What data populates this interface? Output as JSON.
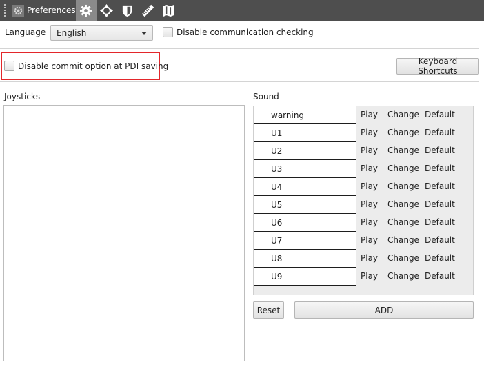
{
  "toolbar": {
    "title": "Preferences",
    "icons": [
      "gear-icon",
      "move-icon",
      "shield-icon",
      "ruler-icon",
      "map-icon"
    ]
  },
  "general": {
    "language_label": "Language",
    "language_value": "English",
    "disable_comm_label": "Disable communication checking",
    "disable_commit_label": "Disable commit option at PDI saving",
    "keyboard_shortcuts_label": "Keyboard Shortcuts"
  },
  "joysticks": {
    "label": "Joysticks"
  },
  "sound": {
    "label": "Sound",
    "play_label": "Play",
    "change_label": "Change",
    "default_label": "Default",
    "items": [
      "warning",
      "U1",
      "U2",
      "U3",
      "U4",
      "U5",
      "U6",
      "U7",
      "U8",
      "U9"
    ],
    "reset_label": "Reset",
    "add_label": "ADD"
  },
  "colors": {
    "toolbar_bg": "#4e4e4e",
    "highlight": "#e3272b"
  }
}
